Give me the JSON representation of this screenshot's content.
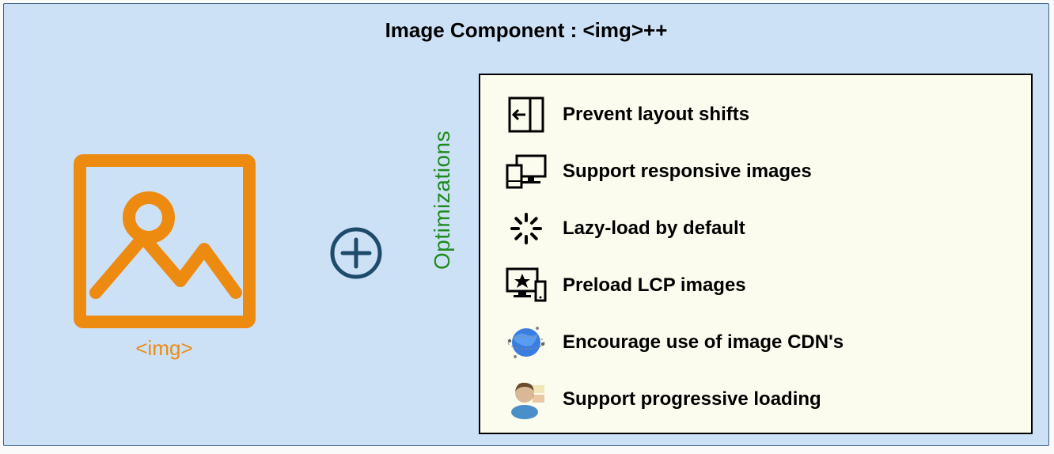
{
  "title": "Image Component : <img>++",
  "img_caption": "<img>",
  "optimizations_label": "Optimizations",
  "optimizations": [
    {
      "label": "Prevent layout shifts",
      "icon": "layout-shift-icon"
    },
    {
      "label": "Support responsive images",
      "icon": "responsive-icon"
    },
    {
      "label": "Lazy-load by default",
      "icon": "spinner-icon"
    },
    {
      "label": "Preload LCP images",
      "icon": "preload-icon"
    },
    {
      "label": "Encourage use of image CDN's",
      "icon": "globe-icon"
    },
    {
      "label": "Support progressive loading",
      "icon": "person-icon"
    }
  ],
  "colors": {
    "bg": "#cde1f6",
    "orange": "#ed8b11",
    "plus": "#1e4b6b",
    "green": "#1e8b1e",
    "box_bg": "#fcfcee"
  }
}
